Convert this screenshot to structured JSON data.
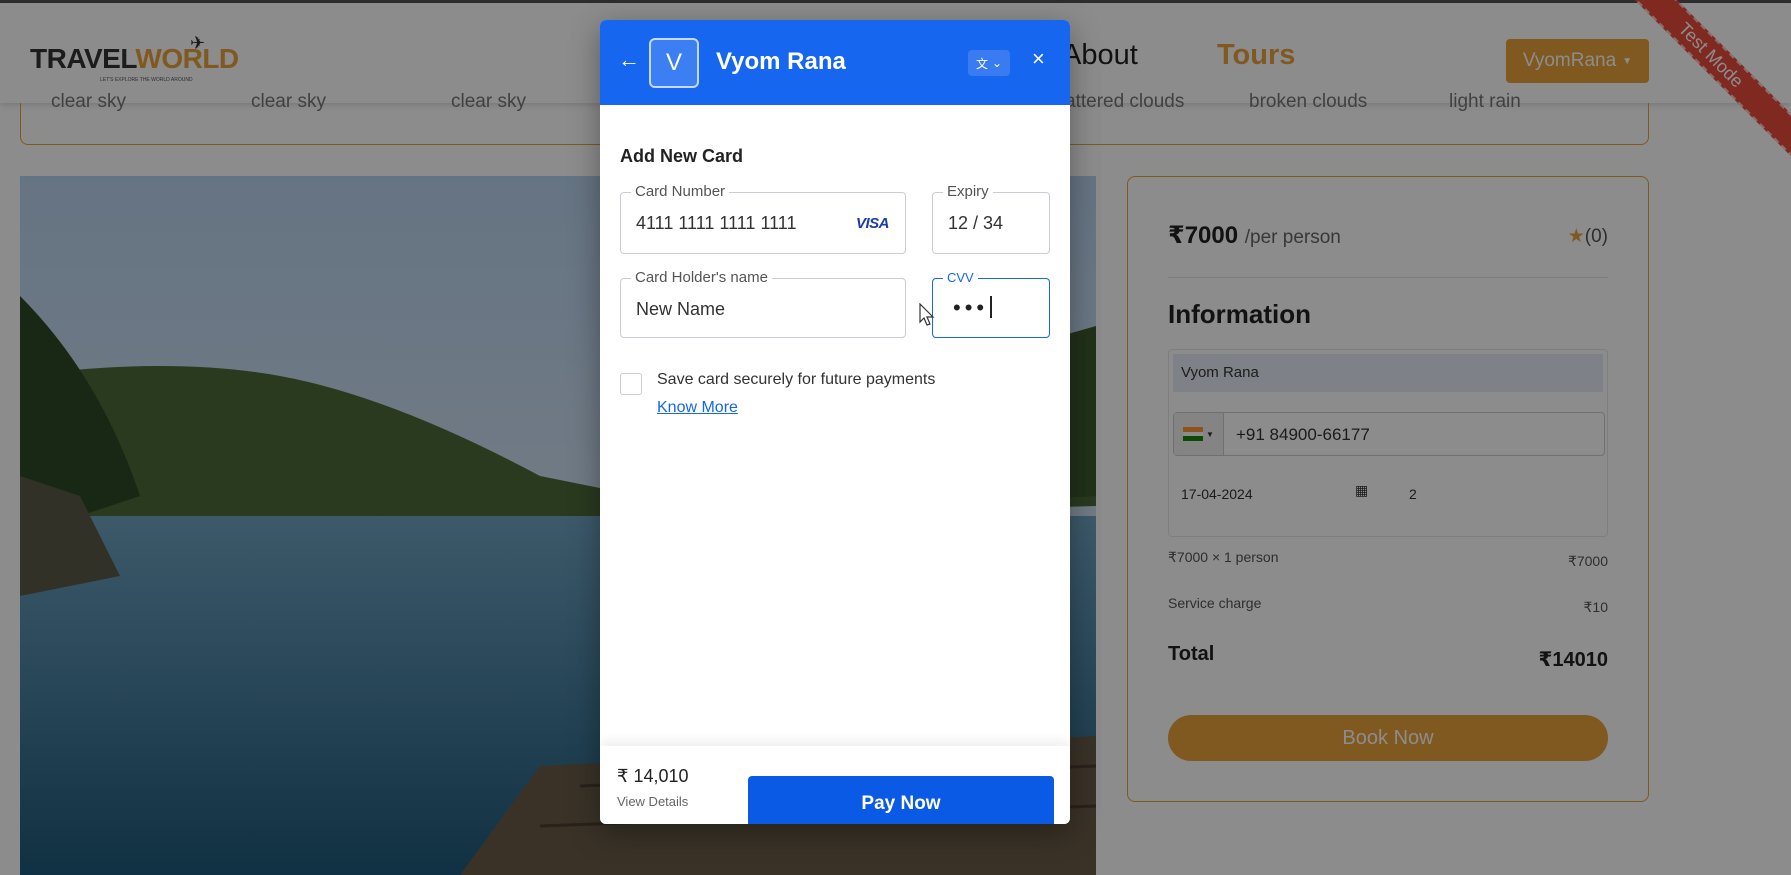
{
  "nav": {
    "logo_part1": "TRAVEL",
    "logo_part2": "WORLD",
    "logo_tagline": "LET'S EXPLORE THE WORLD AROUND",
    "about": "About",
    "tours": "Tours",
    "user": "VyomRana"
  },
  "ribbon": "Test Mode",
  "weather": [
    "clear sky",
    "clear sky",
    "clear sky",
    "scattered clouds",
    "broken clouds",
    "light rain"
  ],
  "booking": {
    "price": "₹7000",
    "per_person": "/per person",
    "rating": "(0)",
    "info_title": "Information",
    "name": "Vyom Rana",
    "phone": "+91 84900-66177",
    "date": "17-04-2024",
    "guests": "2",
    "line1_label": "₹7000 × 1 person",
    "line1_value": "₹7000",
    "service_label": "Service charge",
    "service_value": "₹10",
    "total_label": "Total",
    "total_value": "₹14010",
    "book_label": "Book Now"
  },
  "modal": {
    "avatar_letter": "V",
    "title": "Vyom Rana",
    "section_title": "Add New Card",
    "card_number_label": "Card Number",
    "card_number_value": "4111 1111 1111 1111",
    "card_brand": "VISA",
    "expiry_label": "Expiry",
    "expiry_value": "12 / 34",
    "holder_label": "Card Holder's name",
    "holder_value": "New Name",
    "cvv_label": "CVV",
    "cvv_value": "•••",
    "save_text": "Save card securely for future payments",
    "know_more": "Know More",
    "amount": "₹ 14,010",
    "view_details": "View Details",
    "pay_label": "Pay Now"
  },
  "colors": {
    "accent": "#e9a23b",
    "modal_blue": "#1766f0",
    "pay_blue": "#0a5ae6",
    "ribbon_red": "#e74c3c"
  }
}
